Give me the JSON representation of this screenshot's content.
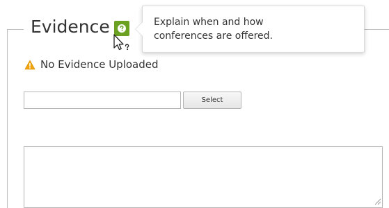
{
  "section": {
    "legend": "Evidence",
    "help_icon": "question-mark-icon",
    "help_tooltip": {
      "line1": "Explain when and how",
      "line2": "conferences are offered."
    },
    "status": {
      "icon": "warning-triangle-icon",
      "text": "No Evidence Uploaded"
    },
    "file_upload": {
      "value": "",
      "placeholder": "",
      "button_label": "Select"
    },
    "notes": {
      "value": "",
      "placeholder": ""
    }
  },
  "colors": {
    "help_icon": "#6aa121",
    "warning": "#f0a30a",
    "border": "#bfbfbf",
    "text": "#333333"
  }
}
